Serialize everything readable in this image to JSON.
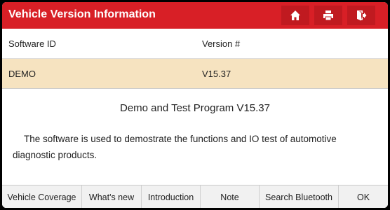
{
  "header": {
    "title": "Vehicle Version Information",
    "buttons": [
      {
        "name": "home-icon"
      },
      {
        "name": "print-icon"
      },
      {
        "name": "exit-icon"
      }
    ]
  },
  "table": {
    "columns": [
      "Software ID",
      "Version #"
    ],
    "rows": [
      [
        "DEMO",
        "V15.37"
      ]
    ]
  },
  "content": {
    "title": "Demo and Test Program V15.37",
    "description": "The software is used to demostrate the functions and IO test of automotive diagnostic products."
  },
  "footer": {
    "buttons": [
      "Vehicle Coverage",
      "What's new",
      "Introduction",
      "Note",
      "Search Bluetooth",
      "OK"
    ]
  },
  "colors": {
    "title_bar": "#d81f26",
    "selected_row": "#f6e3c0"
  }
}
